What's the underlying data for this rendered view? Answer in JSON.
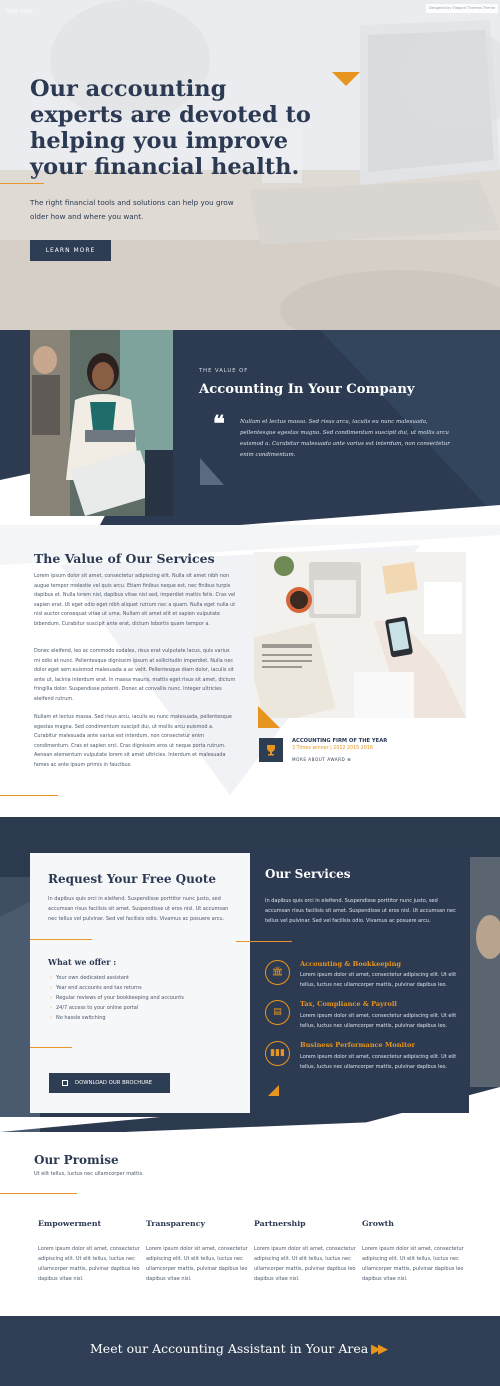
{
  "hero": {
    "logo_text": "logo text",
    "credit": "Designed by Elegant Themes Theme",
    "title": "Our accounting experts are devoted to helping you improve your financial health.",
    "subtitle": "The right financial tools and solutions can help you grow older how and where you want.",
    "cta_label": "LEARN MORE"
  },
  "value_band": {
    "kicker": "THE VALUE OF",
    "title": "Accounting In Your Company",
    "quote": "Nullam et lectus massa. Sed risus arcu, iaculis eu nunc malesuada, pellentesque egestas magna. Sed condimentum suscipit dui, ut mollis arcu euismod a. Curabitur malesuada ante varius est interdum, non consectetur enim condimentum."
  },
  "services_value": {
    "title": "The Value of Our Services",
    "paragraphs": [
      "Lorem ipsum dolor sit amet, consectetur adipiscing elit. Nulla sit amet nibh non augue tempor molestie vel quis arcu. Etiam finibus neque est, nec finibus turpis dapibus et. Nulla lorem nisl, dapibus vitae nisl sed, imperdiet mattis felis. Cras vel sapien erat. Ut eget odio eget nibh aliquet rutrum nec a quam. Nulla eget nulla ut nisl auctor consequat vitae ut urna. Nullam sit amet elit et sapien vulputate bibendum. Curabitur suscipit ante erat, dictum lobortis quam tempor a.",
      "Donec eleifend, leo ac commodo sodales, risus erat vulputate lacus, quis varius mi odio at nunc. Pellentesque dignissim ipsum at sollicitudin imperdiet. Nulla nec dolor eget sem euismod malesuada a ac velit. Pellentesque diam dolor, iaculis sit ante ut, lacinia interdum erat. In massa mauris, mattis eget risus sit amet, dictum fringilla dolor. Suspendisse potenti. Donec at convallis nunc. Integer ultricies eleifend rutrum.",
      "Nullam et lectus massa. Sed risus arcu, iaculis eu nunc malesuada, pellentesque egestas magna. Sed condimentum suscipit dui, ut mollis arcu euismod a. Curabitur malesuada ante varius est interdum, non consectetur enim condimentum. Cras et sapien orci. Cras dignissim eros ut neque porta rutrum. Aenean elementum vulputate lorem sit amet ultricies. Interdum et malesuada fames ac ante ipsum primis in faucibus."
    ],
    "award": {
      "title": "ACCOUNTING FIRM OF THE YEAR",
      "years": "3 Times winner | 2012 2015 2016",
      "link": "MORE ABOUT AWARD"
    }
  },
  "quote_card": {
    "title": "Request Your Free Quote",
    "text": "In dapibus quis orci in eleifend. Suspendisse porttitor nunc justo, sed accumsan risus facilisis sit amet. Suspendisse ut eros nisl. Ut accumsan nec tellus vel pulvinar. Sed vel facilisis odio. Vivamus ac posuere arcu.",
    "offer_title": "What we offer :",
    "offer_items": [
      "Your own dedicated assistant",
      "Year end accounts and tax returns",
      "Regular reviews of your bookkeeping and accounts",
      "24/7 access to your online portal",
      "No hassle switching"
    ],
    "button_label": "DOWNLOAD OUR BROCHURE"
  },
  "our_services": {
    "title": "Our Services",
    "text": "In dapibus quis orci in eleifend. Suspendisse porttitor nunc justo, sed accumsan risus facilisis sit amet. Suspendisse ut eros nisl. Ut accumsan nec tellus vel pulvinar. Sed vel facilisis odio. Vivamus ac posuere arcu.",
    "items": [
      {
        "title": "Accounting & Bookkeeping",
        "text": "Lorem ipsum dolor sit amet, consectetur adipiscing elit. Ut elit tellus, luctus nec ullamcorper mattis, pulvinar dapibus leo.",
        "icon": "bank-icon"
      },
      {
        "title": "Tax, Compliance & Payroll",
        "text": "Lorem ipsum dolor sit amet, consectetur adipiscing elit. Ut elit tellus, luctus nec ullamcorper mattis, pulvinar dapibus leo.",
        "icon": "book-icon"
      },
      {
        "title": "Business Performance Monitor",
        "text": "Lorem ipsum dolor sit amet, consectetur adipiscing elit. Ut elit tellus, luctus nec ullamcorper mattis, pulvinar dapibus leo.",
        "icon": "bar-chart-icon"
      }
    ]
  },
  "promise": {
    "title": "Our Promise",
    "subtitle": "Ut elit tellus, luctus nec ullamcorper mattis.",
    "columns": [
      {
        "title": "Empowerment",
        "text": "Lorem ipsum dolor sit amet, consectetur adipiscing elit. Ut elit tellus, luctus nec ullamcorper mattis, pulvinar dapibus leo dapibus vitae nisl."
      },
      {
        "title": "Transparency",
        "text": "Lorem ipsum dolor sit amet, consectetur adipiscing elit. Ut elit tellus, luctus nec ullamcorper mattis, pulvinar dapibus leo dapibus vitae nisl."
      },
      {
        "title": "Partnership",
        "text": "Lorem ipsum dolor sit amet, consectetur adipiscing elit. Ut elit tellus, luctus nec ullamcorper mattis, pulvinar dapibus leo dapibus vitae nisl."
      },
      {
        "title": "Growth",
        "text": "Lorem ipsum dolor sit amet, consectetur adipiscing elit. Ut elit tellus, luctus nec ullamcorper mattis, pulvinar dapibus leo dapibus vitae nisl."
      }
    ]
  },
  "cta": {
    "text": "Meet our Accounting Assistant in Your Area",
    "arrows": "▶▶"
  },
  "colors": {
    "navy": "#2d3b52",
    "accent": "#e8951f",
    "light": "#f6f7f9"
  }
}
